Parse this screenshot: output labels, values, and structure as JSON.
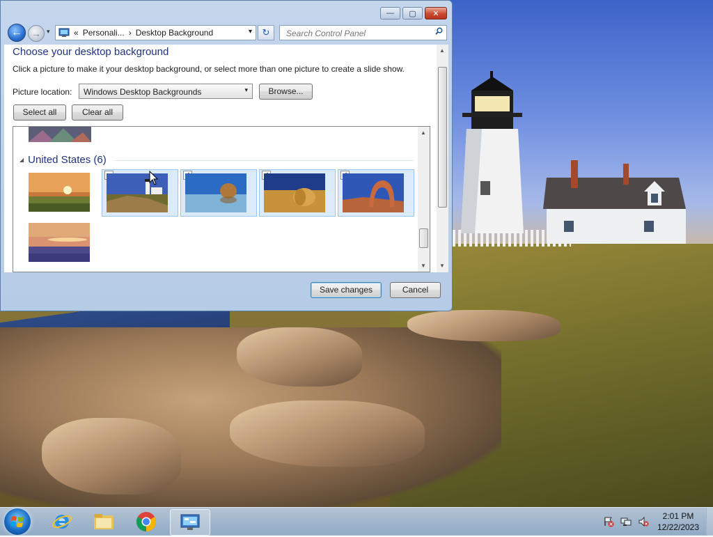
{
  "window": {
    "minimize_label": "—",
    "maximize_label": "▢",
    "close_label": "✕"
  },
  "nav": {
    "back_glyph": "←",
    "forward_glyph": "→",
    "dropdown_glyph": "▾"
  },
  "address": {
    "overflow": "«",
    "crumbs": [
      "Personali...",
      "Desktop Background"
    ],
    "separator": "›",
    "dropdown_glyph": "▾",
    "refresh_glyph": "↻"
  },
  "search": {
    "placeholder": "Search Control Panel"
  },
  "page": {
    "title": "Choose your desktop background",
    "subtitle": "Click a picture to make it your desktop background, or select more than one picture to create a slide show.",
    "location_label": "Picture location:",
    "location_value": "Windows Desktop Backgrounds",
    "browse_label": "Browse...",
    "select_all_label": "Select all",
    "clear_all_label": "Clear all"
  },
  "gallery": {
    "group_title": "United States (6)",
    "group_glyph": "◢",
    "thumbs": [
      {
        "name": "sunset-fields",
        "checked": false,
        "selected": false
      },
      {
        "name": "lighthouse",
        "checked": false,
        "selected": true
      },
      {
        "name": "rock-in-lake",
        "checked": true,
        "selected": true
      },
      {
        "name": "hay-bale",
        "checked": true,
        "selected": true
      },
      {
        "name": "stone-arch",
        "checked": true,
        "selected": true
      },
      {
        "name": "flower-sunset",
        "checked": false,
        "selected": false
      }
    ],
    "check_glyph": "✓"
  },
  "footer": {
    "save_label": "Save changes",
    "cancel_label": "Cancel"
  },
  "taskbar": {
    "time": "2:01 PM",
    "date": "12/22/2023"
  }
}
